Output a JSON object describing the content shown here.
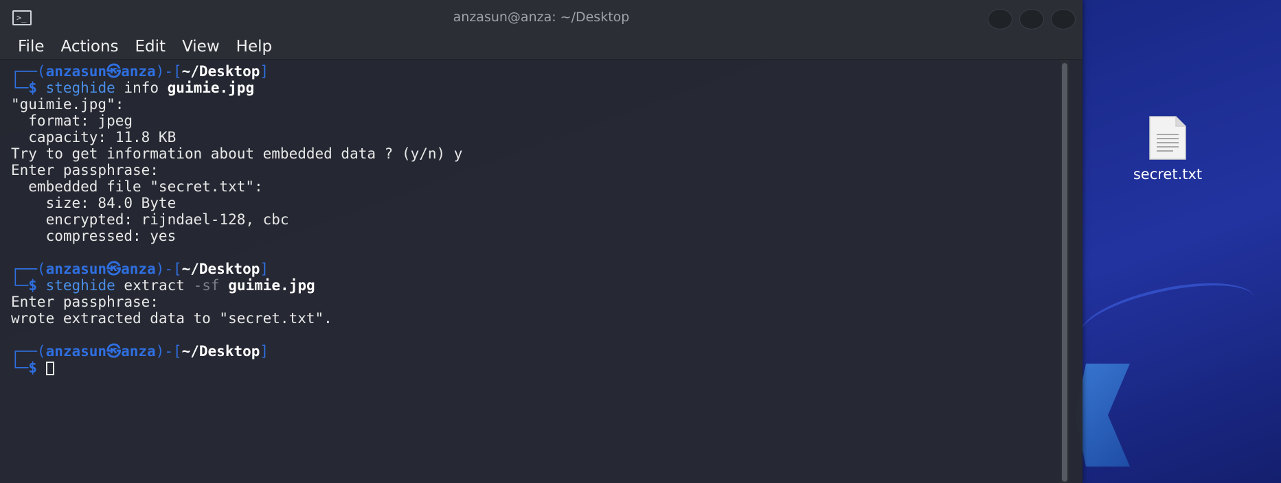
{
  "window": {
    "title": "anzasun@anza: ~/Desktop"
  },
  "menu": [
    "File",
    "Actions",
    "Edit",
    "View",
    "Help"
  ],
  "prompt": {
    "user": "anzasun",
    "host": "anza",
    "dir": "~/Desktop",
    "symbol": "$"
  },
  "terminal": {
    "cmd1": {
      "prog": "steghide",
      "args": "info",
      "file": "guimie.jpg"
    },
    "out1": [
      "\"guimie.jpg\":",
      "  format: jpeg",
      "  capacity: 11.8 KB",
      "Try to get information about embedded data ? (y/n) y",
      "Enter passphrase:",
      "  embedded file \"secret.txt\":",
      "    size: 84.0 Byte",
      "    encrypted: rijndael-128, cbc",
      "    compressed: yes"
    ],
    "cmd2": {
      "prog": "steghide",
      "args": "extract",
      "flag": "-sf",
      "file": "guimie.jpg"
    },
    "out2": [
      "Enter passphrase:",
      "wrote extracted data to \"secret.txt\"."
    ]
  },
  "desktop": {
    "file_label": "secret.txt",
    "file_icon": "text-file-icon"
  },
  "colors": {
    "prompt_blue": "#2f6fe0",
    "terminal_bg": "#262930",
    "desktop_bg": "#1a2a8a"
  }
}
